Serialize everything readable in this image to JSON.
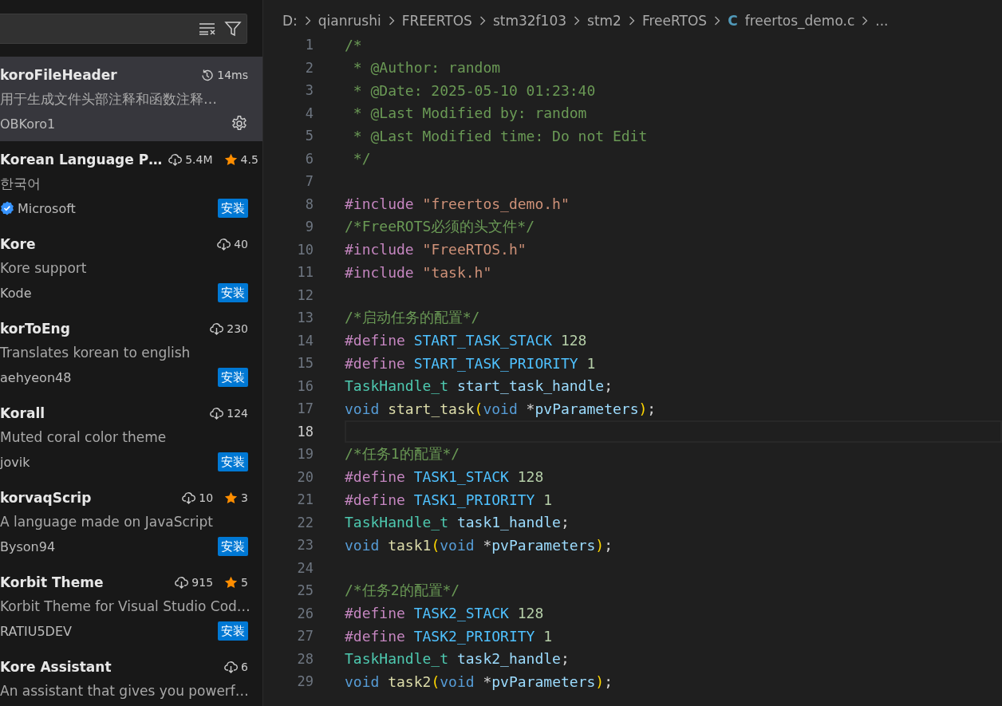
{
  "sidebar": {
    "extensions": [
      {
        "name": "koroFileHeader",
        "description": "用于生成文件头部注释和函数注释…",
        "publisher": "OBKoro1",
        "verified": false,
        "selected": true,
        "stat": {
          "kind": "time",
          "text": "14ms"
        },
        "action": {
          "kind": "manage"
        }
      },
      {
        "name": "Korean Language P…",
        "description": "한국어",
        "publisher": "Microsoft",
        "verified": true,
        "selected": false,
        "stat": {
          "kind": "downloads",
          "text": "5.4M"
        },
        "rating": "4.5",
        "action": {
          "kind": "install",
          "label": "安装"
        }
      },
      {
        "name": "Kore",
        "description": "Kore support",
        "publisher": "Kode",
        "verified": false,
        "selected": false,
        "stat": {
          "kind": "downloads",
          "text": "40"
        },
        "action": {
          "kind": "install",
          "label": "安装"
        }
      },
      {
        "name": "korToEng",
        "description": "Translates korean to english",
        "publisher": "aehyeon48",
        "verified": false,
        "selected": false,
        "stat": {
          "kind": "downloads",
          "text": "230"
        },
        "action": {
          "kind": "install",
          "label": "安装"
        }
      },
      {
        "name": "Korall",
        "description": "Muted coral color theme",
        "publisher": "jovik",
        "verified": false,
        "selected": false,
        "stat": {
          "kind": "downloads",
          "text": "124"
        },
        "action": {
          "kind": "install",
          "label": "安装"
        }
      },
      {
        "name": "korvaqScrip",
        "description": "A language made on JavaScript",
        "publisher": "Byson94",
        "verified": false,
        "selected": false,
        "stat": {
          "kind": "downloads",
          "text": "10"
        },
        "rating": "3",
        "action": {
          "kind": "install",
          "label": "安装"
        }
      },
      {
        "name": "Korbit Theme",
        "description": "Korbit Theme for Visual Studio Cod…",
        "publisher": "RATIU5DEV",
        "verified": false,
        "selected": false,
        "stat": {
          "kind": "downloads",
          "text": "915"
        },
        "rating": "5",
        "action": {
          "kind": "install",
          "label": "安装"
        }
      },
      {
        "name": "Kore Assistant",
        "description": "An assistant that gives you powerf…",
        "selected": false,
        "stat": {
          "kind": "downloads",
          "text": "6"
        }
      }
    ]
  },
  "breadcrumb": {
    "segments": [
      "D:",
      "qianrushi",
      "FREERTOS",
      "stm32f103",
      "stm2",
      "FreeRTOS"
    ],
    "file_icon": "C",
    "file": "freertos_demo.c",
    "more": "..."
  },
  "editor": {
    "lines": [
      {
        "number": "1",
        "current": false,
        "tokens": [
          {
            "kind": "comment",
            "text": "/*"
          }
        ]
      },
      {
        "number": "2",
        "current": false,
        "tokens": [
          {
            "kind": "comment",
            "text": " * @Author: random"
          }
        ]
      },
      {
        "number": "3",
        "current": false,
        "tokens": [
          {
            "kind": "comment",
            "text": " * @Date: 2025-05-10 01:23:40"
          }
        ]
      },
      {
        "number": "4",
        "current": false,
        "tokens": [
          {
            "kind": "comment",
            "text": " * @Last Modified by: random"
          }
        ]
      },
      {
        "number": "5",
        "current": false,
        "tokens": [
          {
            "kind": "comment",
            "text": " * @Last Modified time: Do not Edit"
          }
        ]
      },
      {
        "number": "6",
        "current": false,
        "tokens": [
          {
            "kind": "comment",
            "text": " */"
          }
        ]
      },
      {
        "number": "7",
        "current": false
      },
      {
        "number": "8",
        "current": false,
        "tokens": [
          {
            "kind": "directive",
            "text": "#include"
          },
          {
            "kind": "string",
            "text": " \"freertos_demo.h\""
          }
        ]
      },
      {
        "number": "9",
        "current": false,
        "tokens": [
          {
            "kind": "comment",
            "text": "/*FreeROTS必须的头文件*/"
          }
        ]
      },
      {
        "number": "10",
        "current": false,
        "tokens": [
          {
            "kind": "directive",
            "text": "#include"
          },
          {
            "kind": "string",
            "text": " \"FreeRTOS.h\""
          }
        ]
      },
      {
        "number": "11",
        "current": false,
        "tokens": [
          {
            "kind": "directive",
            "text": "#include"
          },
          {
            "kind": "string",
            "text": " \"task.h\""
          }
        ]
      },
      {
        "number": "12",
        "current": false
      },
      {
        "number": "13",
        "current": false,
        "tokens": [
          {
            "kind": "comment",
            "text": "/*启动任务的配置*/"
          }
        ]
      },
      {
        "number": "14",
        "current": false,
        "tokens": [
          {
            "kind": "directive",
            "text": "#define"
          },
          {
            "kind": "macro",
            "text": " START_TASK_STACK"
          },
          {
            "kind": "number",
            "text": " 128"
          }
        ]
      },
      {
        "number": "15",
        "current": false,
        "tokens": [
          {
            "kind": "directive",
            "text": "#define"
          },
          {
            "kind": "macro",
            "text": " START_TASK_PRIORITY"
          },
          {
            "kind": "number",
            "text": " 1"
          }
        ]
      },
      {
        "number": "16",
        "current": false,
        "tokens": [
          {
            "kind": "type",
            "text": "TaskHandle_t"
          },
          {
            "kind": "variable",
            "text": " start_task_handle"
          },
          {
            "kind": "plain",
            "text": ";"
          }
        ]
      },
      {
        "number": "17",
        "current": false,
        "tokens": [
          {
            "kind": "keyword",
            "text": "void"
          },
          {
            "kind": "function",
            "text": " start_task"
          },
          {
            "kind": "bracket",
            "text": "("
          },
          {
            "kind": "keyword",
            "text": "void"
          },
          {
            "kind": "plain",
            "text": " *"
          },
          {
            "kind": "variable",
            "text": "pvParameters"
          },
          {
            "kind": "bracket",
            "text": ")"
          },
          {
            "kind": "plain",
            "text": ";"
          }
        ]
      },
      {
        "number": "18",
        "current": true
      },
      {
        "number": "19",
        "current": false,
        "tokens": [
          {
            "kind": "comment",
            "text": "/*任务1的配置*/"
          }
        ]
      },
      {
        "number": "20",
        "current": false,
        "tokens": [
          {
            "kind": "directive",
            "text": "#define"
          },
          {
            "kind": "macro",
            "text": " TASK1_STACK"
          },
          {
            "kind": "number",
            "text": " 128"
          }
        ]
      },
      {
        "number": "21",
        "current": false,
        "tokens": [
          {
            "kind": "directive",
            "text": "#define"
          },
          {
            "kind": "macro",
            "text": " TASK1_PRIORITY"
          },
          {
            "kind": "number",
            "text": " 1"
          }
        ]
      },
      {
        "number": "22",
        "current": false,
        "tokens": [
          {
            "kind": "type",
            "text": "TaskHandle_t"
          },
          {
            "kind": "variable",
            "text": " task1_handle"
          },
          {
            "kind": "plain",
            "text": ";"
          }
        ]
      },
      {
        "number": "23",
        "current": false,
        "tokens": [
          {
            "kind": "keyword",
            "text": "void"
          },
          {
            "kind": "function",
            "text": " task1"
          },
          {
            "kind": "bracket",
            "text": "("
          },
          {
            "kind": "keyword",
            "text": "void"
          },
          {
            "kind": "plain",
            "text": " *"
          },
          {
            "kind": "variable",
            "text": "pvParameters"
          },
          {
            "kind": "bracket",
            "text": ")"
          },
          {
            "kind": "plain",
            "text": ";"
          }
        ]
      },
      {
        "number": "24",
        "current": false
      },
      {
        "number": "25",
        "current": false,
        "tokens": [
          {
            "kind": "comment",
            "text": "/*任务2的配置*/"
          }
        ]
      },
      {
        "number": "26",
        "current": false,
        "tokens": [
          {
            "kind": "directive",
            "text": "#define"
          },
          {
            "kind": "macro",
            "text": " TASK2_STACK"
          },
          {
            "kind": "number",
            "text": " 128"
          }
        ]
      },
      {
        "number": "27",
        "current": false,
        "tokens": [
          {
            "kind": "directive",
            "text": "#define"
          },
          {
            "kind": "macro",
            "text": " TASK2_PRIORITY"
          },
          {
            "kind": "number",
            "text": " 1"
          }
        ]
      },
      {
        "number": "28",
        "current": false,
        "tokens": [
          {
            "kind": "type",
            "text": "TaskHandle_t"
          },
          {
            "kind": "variable",
            "text": " task2_handle"
          },
          {
            "kind": "plain",
            "text": ";"
          }
        ]
      },
      {
        "number": "29",
        "current": false,
        "tokens": [
          {
            "kind": "keyword",
            "text": "void"
          },
          {
            "kind": "function",
            "text": " task2"
          },
          {
            "kind": "bracket",
            "text": "("
          },
          {
            "kind": "keyword",
            "text": "void"
          },
          {
            "kind": "plain",
            "text": " *"
          },
          {
            "kind": "variable",
            "text": "pvParameters"
          },
          {
            "kind": "bracket",
            "text": ")"
          },
          {
            "kind": "plain",
            "text": ";"
          }
        ]
      }
    ]
  }
}
